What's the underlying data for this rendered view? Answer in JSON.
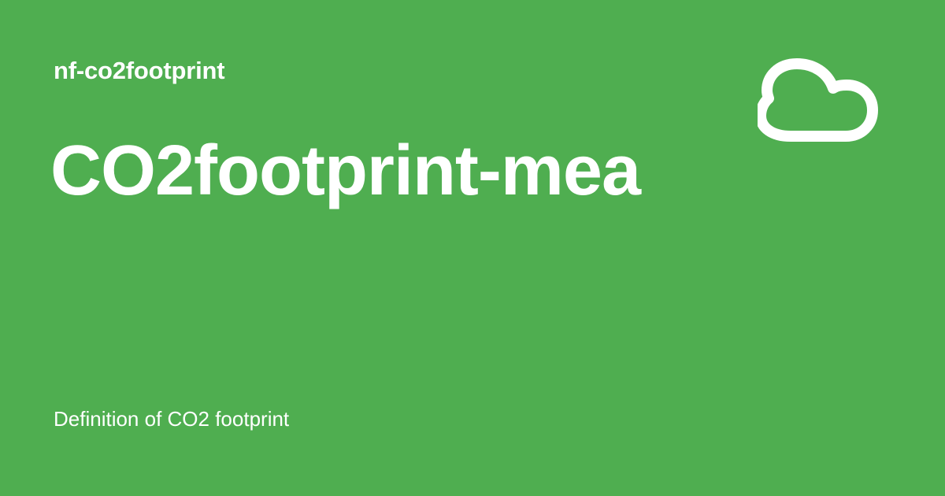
{
  "header": {
    "eyebrow": "nf-co2footprint"
  },
  "main": {
    "title": "CO2footprint-mea",
    "description": "Definition of CO2 footprint"
  },
  "visual": {
    "icon": "cloud-icon"
  },
  "colors": {
    "background": "#4fae50",
    "text": "#ffffff"
  }
}
